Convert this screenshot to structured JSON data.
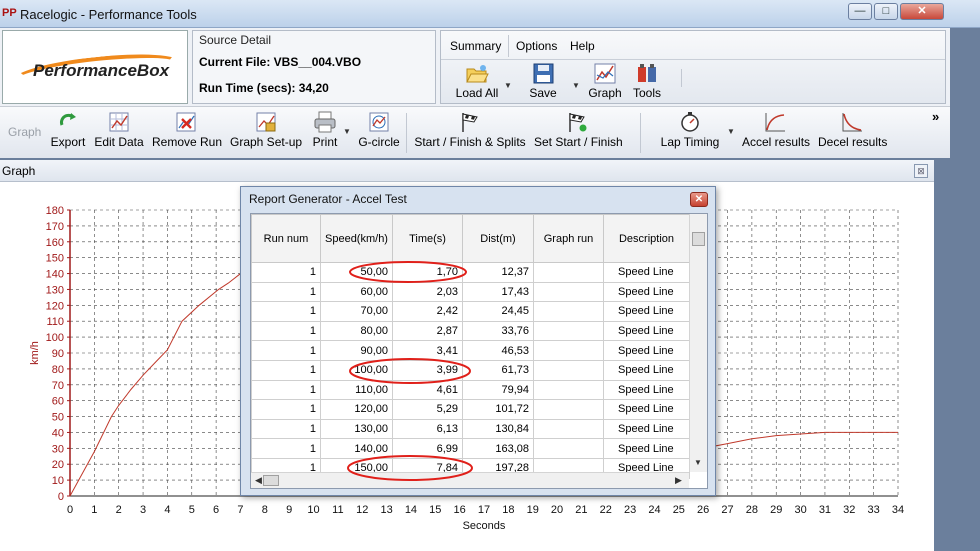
{
  "window": {
    "icon_text": "PP",
    "title": "Racelogic - Performance Tools",
    "min_glyph": "—",
    "max_glyph": "□",
    "close_glyph": "✕"
  },
  "logo": {
    "text": "PerformanceBox"
  },
  "source_detail": {
    "title": "Source Detail",
    "current_file": "Current File: VBS__004.VBO",
    "run_time": "Run Time (secs): 34,20"
  },
  "menu": {
    "tabs": [
      "Summary",
      "Options",
      "Help"
    ],
    "buttons": [
      {
        "label": "Load All",
        "icon": "folder-open-icon"
      },
      {
        "label": "Save",
        "icon": "floppy-disk-icon"
      },
      {
        "label": "Graph",
        "icon": "graph-icon"
      },
      {
        "label": "Tools",
        "icon": "tools-icon"
      }
    ]
  },
  "toolbar": {
    "graph_label": "Graph",
    "buttons": [
      {
        "label": "Export",
        "icon": "export-icon"
      },
      {
        "label": "Edit Data",
        "icon": "edit-data-icon"
      },
      {
        "label": "Remove Run",
        "icon": "remove-run-icon"
      },
      {
        "label": "Graph Set-up",
        "icon": "graph-setup-icon"
      },
      {
        "label": "Print",
        "icon": "printer-icon"
      },
      {
        "label": "G-circle",
        "icon": "g-circle-icon"
      },
      {
        "label": "Start / Finish & Splits",
        "icon": "checkered-flag-icon"
      },
      {
        "label": "Set Start / Finish",
        "icon": "set-flag-icon"
      },
      {
        "label": "Lap Timing",
        "icon": "stopwatch-icon"
      },
      {
        "label": "Accel results",
        "icon": "accel-curve-icon"
      },
      {
        "label": "Decel results",
        "icon": "decel-curve-icon"
      }
    ],
    "overflow_glyph": "»"
  },
  "graph_panel": {
    "title": "Graph",
    "close_glyph": "⊠"
  },
  "chart_data": {
    "type": "line",
    "xlabel": "Seconds",
    "ylabel": "km/h",
    "xlim": [
      0,
      34
    ],
    "ylim": [
      0,
      180
    ],
    "x_ticks": [
      0,
      1,
      2,
      3,
      4,
      5,
      6,
      7,
      8,
      9,
      10,
      11,
      12,
      13,
      14,
      15,
      16,
      17,
      18,
      19,
      20,
      21,
      22,
      23,
      24,
      25,
      26,
      27,
      28,
      29,
      30,
      31,
      32,
      33,
      34
    ],
    "y_ticks": [
      0,
      10,
      20,
      30,
      40,
      50,
      60,
      70,
      80,
      90,
      100,
      110,
      120,
      130,
      140,
      150,
      160,
      170,
      180
    ],
    "grid": true,
    "line_color": "#c0392b",
    "axis_color": "#a11a1a",
    "series": [
      {
        "x": [
          0,
          0.5,
          1,
          1.7,
          2,
          2.5,
          3,
          3.5,
          4,
          4.6,
          5.3,
          6.1,
          6.5,
          7,
          26,
          27,
          28,
          29,
          30,
          31,
          32,
          33,
          34
        ],
        "y": [
          0,
          14,
          28,
          50,
          57,
          67,
          76,
          84,
          92,
          110,
          120,
          130,
          134,
          140,
          30,
          33,
          36,
          38,
          39,
          40,
          40,
          40,
          40
        ]
      }
    ]
  },
  "dialog": {
    "title": "Report Generator - Accel Test",
    "close_glyph": "✕",
    "columns": [
      "Run num",
      "Speed(km/h)",
      "Time(s)",
      "Dist(m)",
      "Graph run",
      "Description"
    ],
    "rows": [
      [
        "1",
        "50,00",
        "1,70",
        "12,37",
        "",
        "Speed Line"
      ],
      [
        "1",
        "60,00",
        "2,03",
        "17,43",
        "",
        "Speed Line"
      ],
      [
        "1",
        "70,00",
        "2,42",
        "24,45",
        "",
        "Speed Line"
      ],
      [
        "1",
        "80,00",
        "2,87",
        "33,76",
        "",
        "Speed Line"
      ],
      [
        "1",
        "90,00",
        "3,41",
        "46,53",
        "",
        "Speed Line"
      ],
      [
        "1",
        "100,00",
        "3,99",
        "61,73",
        "",
        "Speed Line"
      ],
      [
        "1",
        "110,00",
        "4,61",
        "79,94",
        "",
        "Speed Line"
      ],
      [
        "1",
        "120,00",
        "5,29",
        "101,72",
        "",
        "Speed Line"
      ],
      [
        "1",
        "130,00",
        "6,13",
        "130,84",
        "",
        "Speed Line"
      ],
      [
        "1",
        "140,00",
        "6,99",
        "163,08",
        "",
        "Speed Line"
      ],
      [
        "1",
        "150,00",
        "7,84",
        "197,28",
        "",
        "Speed Line"
      ]
    ],
    "scroll_down_glyph": "▼",
    "scroll_left_glyph": "◀",
    "scroll_right_glyph": "▶",
    "highlight_color": "#e0201a"
  }
}
